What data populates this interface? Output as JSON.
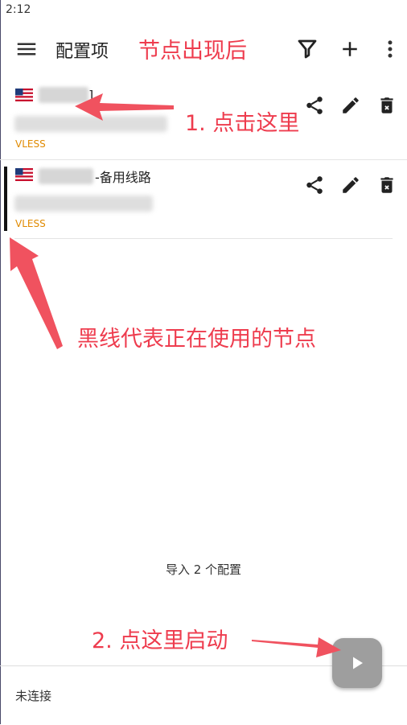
{
  "status_bar": {
    "time": "2:12"
  },
  "toolbar": {
    "title": "配置项",
    "menu_icon": "menu-icon",
    "filter_icon": "filter-icon",
    "add_icon": "plus-icon",
    "more_icon": "more-vert-icon"
  },
  "configs": [
    {
      "flag": "🇺🇸",
      "name_suffix": "]",
      "type": "VLESS",
      "active": false
    },
    {
      "flag": "🇺🇸",
      "name_suffix": "-备用线路",
      "type": "VLESS",
      "active": true
    }
  ],
  "import_count": "导入 2 个配置",
  "footer": {
    "status": "未连接"
  },
  "fab": {
    "icon": "play-icon"
  },
  "annotations": {
    "title_note": "节点出现后",
    "step1": "1. 点击这里",
    "active_note": "黑线代表正在使用的节点",
    "step2": "2. 点这里启动"
  },
  "colors": {
    "type_label": "#e08a00",
    "annotation": "#ee3c4e",
    "active_bar": "#111111",
    "fab": "#9e9e9e"
  }
}
